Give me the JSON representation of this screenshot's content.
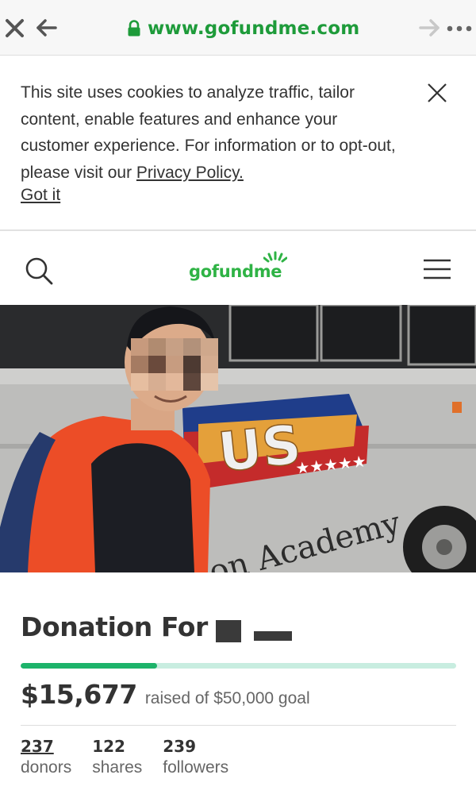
{
  "browser": {
    "url": "www.gofundme.com",
    "icons": [
      "close-icon",
      "back-arrow-icon",
      "lock-icon",
      "forward-arrow-icon",
      "more-icon"
    ]
  },
  "cookie_banner": {
    "text": "This site uses cookies to analyze traffic, tailor content, enable features and enhance your customer experience. For information or to opt-out, please visit our ",
    "privacy_link": "Privacy Policy.",
    "got_it": "Got it"
  },
  "header": {
    "logo": "gofundme",
    "icons": [
      "search-icon",
      "menu-icon"
    ]
  },
  "hero": {
    "image": "photo of a person in a red jacket and backpack standing next to a white bus",
    "bus_logo_text": "US",
    "bus_text": "on Academy"
  },
  "campaign": {
    "title": "Donation For",
    "raised_amount": "$15,677",
    "raised_suffix": "raised of $50,000 goal",
    "progress_percent": 31.4
  },
  "stats": [
    {
      "value": "237",
      "label": "donors"
    },
    {
      "value": "122",
      "label": "shares"
    },
    {
      "value": "239",
      "label": "followers"
    }
  ],
  "colors": {
    "url_green": "#1e9b3a",
    "logo_green": "#2fb345",
    "progress_fill": "#1db36a",
    "progress_track": "#c8ede0"
  }
}
